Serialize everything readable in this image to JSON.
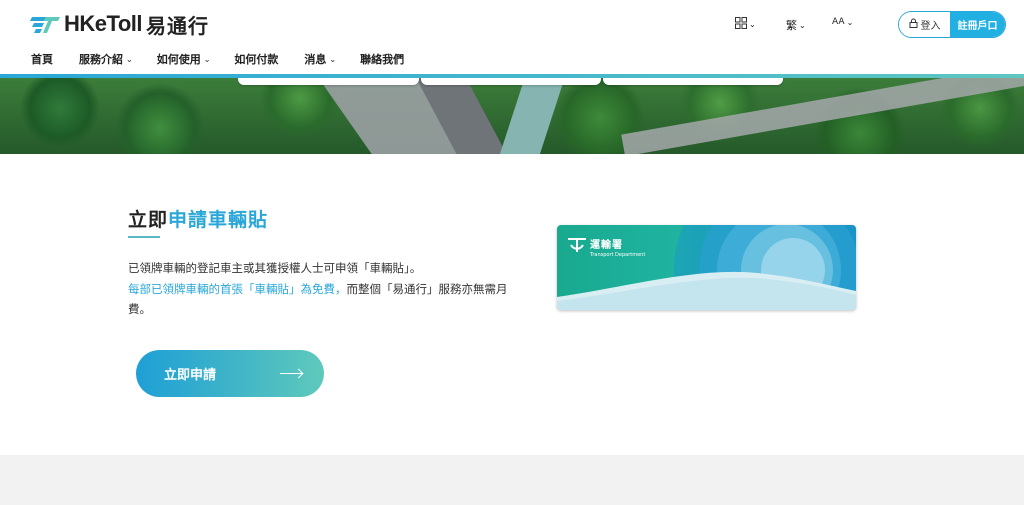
{
  "brand": {
    "name_en": "HKeToll",
    "name_cn": "易通行"
  },
  "nav": {
    "items": [
      {
        "label": "首頁",
        "has_menu": false
      },
      {
        "label": "服務介紹",
        "has_menu": true
      },
      {
        "label": "如何使用",
        "has_menu": true
      },
      {
        "label": "如何付款",
        "has_menu": false
      },
      {
        "label": "消息",
        "has_menu": true
      },
      {
        "label": "聯絡我們",
        "has_menu": false
      }
    ]
  },
  "tools": {
    "apps_icon": "grid-icon",
    "language": "繁",
    "font_size": "AA"
  },
  "auth": {
    "login_label": "登入",
    "register_label": "註冊戶口"
  },
  "section": {
    "title_part1": "立即",
    "title_part2": "申請車輛貼",
    "para_line1": "已領牌車輛的登記車主或其獲授權人士可申領「車輛貼」。",
    "para_highlight": "每部已領牌車輛的首張「車輛貼」為免費，",
    "para_rest": "而整個「易通行」服務亦無需月費。",
    "apply_label": "立即申請"
  },
  "card": {
    "dept_cn": "運輸署",
    "dept_en": "Transport Department"
  },
  "colors": {
    "accent": "#2aa7d8",
    "teal": "#5fc9bb",
    "text": "#222222"
  }
}
